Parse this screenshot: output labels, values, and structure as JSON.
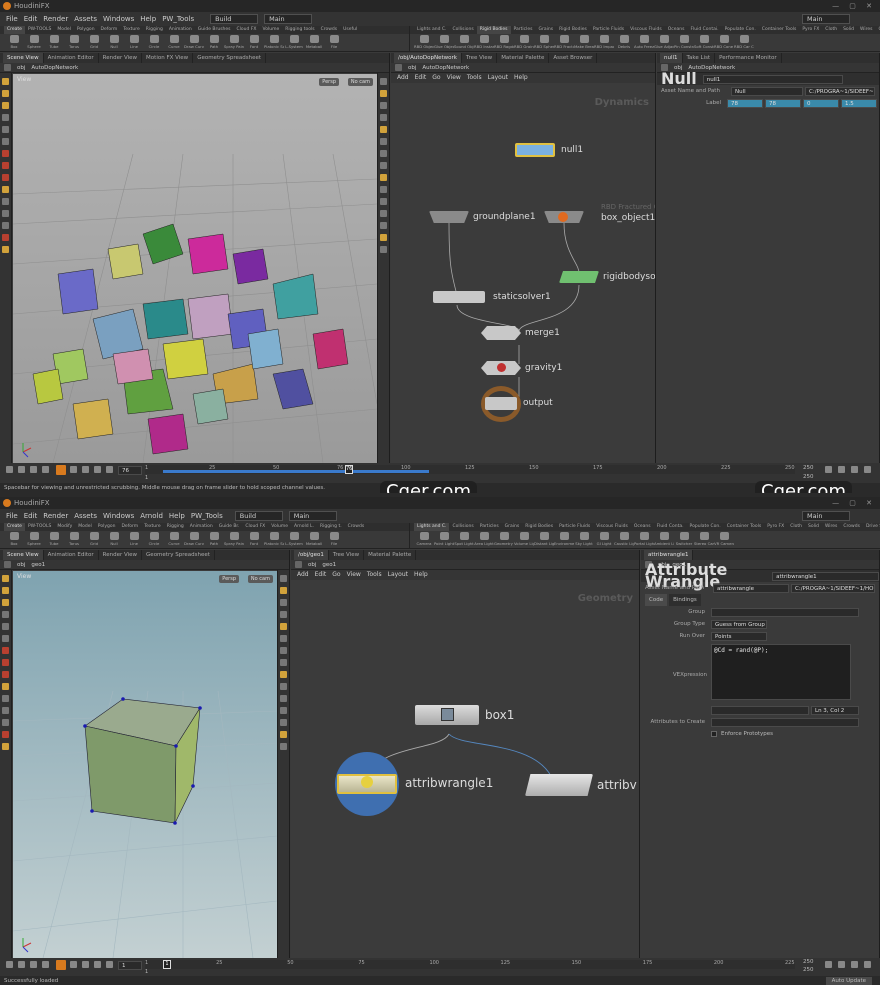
{
  "top": {
    "title": "HoudiniFX",
    "menu": [
      "File",
      "Edit",
      "Render",
      "Assets",
      "Windows",
      "Help",
      "PW_Tools"
    ],
    "desktop": "Build",
    "main_left": "Main",
    "main_right": "Main",
    "shelf_tabs_left": [
      "Create",
      "PW-TOOLS",
      "Model",
      "Polygon",
      "Deform",
      "Texture",
      "Rigging",
      "Animation",
      "Guide Brushes",
      "Cloud FX",
      "Volume",
      "Rigging tools",
      "Crowds",
      "Useful"
    ],
    "shelf_tools_left": [
      "Box",
      "Sphere",
      "Tube",
      "Torus",
      "Grid",
      "Null",
      "Line",
      "Circle",
      "Curve",
      "Draw Curve",
      "Path",
      "Spray Paint",
      "Font",
      "Platonic Solids",
      "L-System",
      "Metaball",
      "File"
    ],
    "shelf_tabs_right": [
      "Lights and C.",
      "Collisions",
      "Rigid Bodies",
      "Particles",
      "Grains",
      "Rigid Bodies",
      "Particle Fluids",
      "Viscous Fluids",
      "Oceans",
      "Fluid Contai.",
      "Populate Con.",
      "Container Tools",
      "Pyro FX",
      "Cloth",
      "Solid",
      "Wires",
      "Crowds",
      "Drive Simula."
    ],
    "shelf_tools_right": [
      "RBD Objects",
      "Glue Object",
      "Sound Objects",
      "RBD Instanced Objects",
      "RBD Ragdoll",
      "RBD Grains",
      "RBD Spheres Objects",
      "RBD Fractured Object",
      "Make Breakable",
      "RBD Impacts",
      "Debris",
      "Auto Freeze",
      "Glue Adjacent",
      "Pin Constraint",
      "Soft Constraint",
      "RBD Cone Twist Const",
      "RBD Car Condition"
    ],
    "left_tabs": [
      "Scene View",
      "Animation Editor",
      "Render View",
      "Motion FX View",
      "Geometry Spreadsheet"
    ],
    "left_path": [
      "obj",
      "AutoDopNetwork"
    ],
    "viewport_label": "View",
    "persp": "Persp",
    "cam": "No cam",
    "net_tabs": [
      "/obj/AutoDopNetwork",
      "Tree View",
      "Material Palette",
      "Asset Browser"
    ],
    "net_path": [
      "obj",
      "AutoDopNetwork"
    ],
    "net_menu": [
      "Add",
      "Edit",
      "Go",
      "View",
      "Tools",
      "Layout",
      "Help"
    ],
    "net_title": "Dynamics",
    "nodes": {
      "null": "null1",
      "ground": "groundplane1",
      "box": "box_object1",
      "box_hint": "RBD Fractured Object",
      "static": "staticsolver1",
      "rigid": "rigidbodysolver1",
      "merge": "merge1",
      "gravity": "gravity1",
      "output": "output"
    },
    "param_tabs": [
      "null1",
      "Take List",
      "Performance Monitor"
    ],
    "param_path": [
      "obj",
      "AutoDopNetwork"
    ],
    "param_type": "Null",
    "param_name": "null1",
    "asset_label": "Asset Name and Path",
    "asset_value": "Null",
    "asset_path": "C:/PROGRA~1/SIDEEF~1/HOUDIN~1.633/houdini/otls/OPlibDop.hda",
    "label_label": "Label",
    "label_vals": [
      "78",
      "78",
      "0",
      "1.5"
    ],
    "frame": "76",
    "tl_start": "1",
    "tl_end": "240",
    "tl_end2": "250",
    "ticks": [
      "1",
      "25",
      "50",
      "76",
      "100",
      "125",
      "150",
      "175",
      "200",
      "225",
      "250"
    ],
    "status": "Spacebar for viewing and unrestricted scrubbing. Middle mouse drag on frame slider to hold scoped channel values.",
    "watermark1": "Cger.com",
    "watermark2": "Cger.com"
  },
  "bottom": {
    "title": "HoudiniFX",
    "menu": [
      "File",
      "Edit",
      "Render",
      "Assets",
      "Windows",
      "Arnold",
      "Help",
      "PW_Tools"
    ],
    "desktop": "Build",
    "main_left": "Main",
    "main_right": "Main",
    "shelf_tabs_left": [
      "Create",
      "PW-TOOLS",
      "Modify",
      "Model",
      "Polygon",
      "Deform",
      "Texture",
      "Rigging",
      "Animation",
      "Guide Br.",
      "Cloud FX",
      "Volume",
      "Arnold L.",
      "Rigging t.",
      "Crowds"
    ],
    "shelf_tools_left": [
      "Box",
      "Sphere",
      "Tube",
      "Torus",
      "Grid",
      "Null",
      "Line",
      "Circle",
      "Curve",
      "Draw Curve",
      "Path",
      "Spray Paint",
      "Font",
      "Platonic Solids",
      "L-System",
      "Metaball",
      "File"
    ],
    "shelf_tabs_right": [
      "Lights and C.",
      "Collisions",
      "Particles",
      "Grains",
      "Rigid Bodies",
      "Particle Fluids",
      "Viscous Fluids",
      "Oceans",
      "Fluid Conta.",
      "Populate Con.",
      "Container Tools",
      "Pyro FX",
      "Cloth",
      "Solid",
      "Wires",
      "Crowds",
      "Drive Simula."
    ],
    "shelf_tools_right": [
      "Camera",
      "Point Light",
      "Spot Light",
      "Area Light",
      "Geometry Light",
      "Volume Light",
      "Distant Light",
      "Environment Light",
      "Sky Light",
      "GI Light",
      "Caustic Light",
      "Portal Light",
      "Ambient Light",
      "Switcher",
      "Stereo Camera",
      "VR Camera"
    ],
    "left_tabs": [
      "Scene View",
      "Animation Editor",
      "Render View",
      "Geometry Spreadsheet"
    ],
    "left_path": [
      "obj",
      "geo1"
    ],
    "viewport_label": "View",
    "persp": "Persp",
    "cam": "No cam",
    "net_tabs": [
      "/obj/geo1",
      "Tree View",
      "Material Palette"
    ],
    "net_path": [
      "obj",
      "geo1"
    ],
    "net_menu": [
      "Add",
      "Edit",
      "Go",
      "View",
      "Tools",
      "Layout",
      "Help"
    ],
    "net_title": "Geometry",
    "nodes": {
      "box": "box1",
      "wrangle": "attribwrangle1",
      "wrangle2": "attribv"
    },
    "param_tabs": [
      "attribwrangle1"
    ],
    "param_path": [
      "obj",
      "geo1"
    ],
    "param_type": "Attribute Wrangle",
    "param_name": "attribwrangle1",
    "asset_label": "Asset Name and Path",
    "asset_value": "attribwrangle",
    "asset_path": "C:/PROGRA~1/SIDEEF~1/HOUDIN~1.597/houdini/otls/OPlibSop.hda",
    "sub_tabs": [
      "Code",
      "Bindings"
    ],
    "group_label": "Group",
    "group_type_label": "Group Type",
    "group_type": "Guess from Group",
    "run_over_label": "Run Over",
    "run_over": "Points",
    "vex_label": "VEXpression",
    "vex_code": "@Cd = rand(@P);",
    "cursor_pos": "Ln 3, Col 2",
    "attr_create_label": "Attributes to Create",
    "enforce": "Enforce Prototypes",
    "frame": "1",
    "tl_start": "1",
    "tl_end": "240",
    "tl_end2": "250",
    "ticks": [
      "1",
      "25",
      "50",
      "75",
      "100",
      "125",
      "150",
      "175",
      "200",
      "225"
    ],
    "status": "Successfully loaded",
    "auto_update": "Auto Update"
  }
}
